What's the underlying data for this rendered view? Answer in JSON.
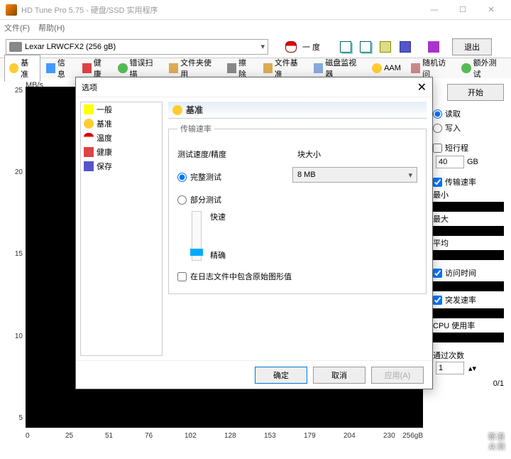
{
  "window": {
    "title": "HD Tune Pro 5.75 - 硬盘/SSD 实用程序"
  },
  "menu": {
    "file": "文件(F)",
    "help": "帮助(H)"
  },
  "drive": {
    "label": "Lexar  LRWCFX2 (256 gB)"
  },
  "toolbar": {
    "temp": "一 度",
    "exit": "退出"
  },
  "tabs": {
    "benchmark": "基准",
    "info": "信息",
    "health": "健康",
    "errscan": "错误扫描",
    "folder": "文件夹使用",
    "erase": "擦除",
    "filebench": "文件基准",
    "monitor": "磁盘监视器",
    "aam": "AAM",
    "random": "随机访问",
    "extra": "额外测试"
  },
  "chart": {
    "unit": "MB/s"
  },
  "chart_data": {
    "type": "line",
    "title": "",
    "xlabel": "",
    "ylabel": "MB/s",
    "x_ticks": [
      0,
      25,
      51,
      76,
      102,
      128,
      153,
      179,
      204,
      230,
      "256gB"
    ],
    "y_ticks": [
      5,
      10,
      15,
      20,
      25
    ],
    "ylim": [
      0,
      25
    ],
    "series": [
      {
        "name": "传输速率",
        "values": []
      }
    ]
  },
  "side": {
    "start": "开始",
    "read": "读取",
    "write": "写入",
    "shortstroke": "短行程",
    "shortval": "40",
    "shortunit": "GB",
    "transfer": "传输速率",
    "min": "最小",
    "max": "最大",
    "avg": "平均",
    "access": "访问时间",
    "burst": "突发速率",
    "cpu": "CPU 使用率",
    "count_label": "通过次数",
    "count_val": "1",
    "counter": "0/1"
  },
  "dialog": {
    "title": "选项",
    "tree": {
      "general": "一般",
      "benchmark": "基准",
      "temp": "温度",
      "health": "健康",
      "save": "保存"
    },
    "head": "基准",
    "group": "传输速率",
    "speed_label": "测试速度/精度",
    "block_label": "块大小",
    "full": "完整测试",
    "partial": "部分测试",
    "block_val": "8 MB",
    "fast": "快速",
    "accurate": "精确",
    "raw_log": "在日志文件中包含原始图形值",
    "ok": "确定",
    "cancel": "取消",
    "apply": "应用(A)"
  },
  "watermark": {
    "l1": "新浪",
    "l2": "众测"
  }
}
